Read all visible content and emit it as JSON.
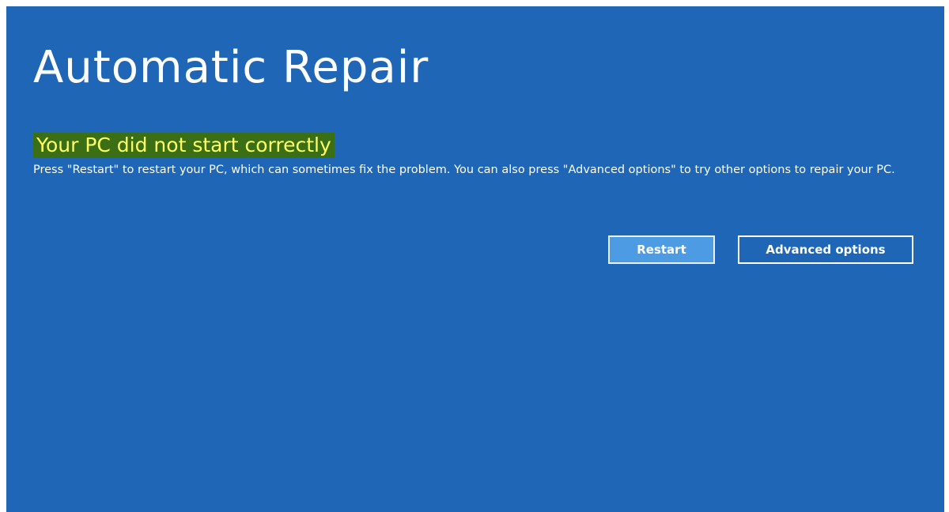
{
  "screen": {
    "title": "Automatic Repair",
    "subtitle": "Your PC did not start correctly",
    "message": "Press \"Restart\" to restart your PC, which can sometimes fix the problem. You can also press \"Advanced options\" to try other options to repair your PC.",
    "buttons": {
      "restart_label": "Restart",
      "advanced_label": "Advanced options"
    }
  },
  "colors": {
    "background": "#1f66b7",
    "subtitle_highlight": "#3b6f16",
    "subtitle_text": "#ffff66",
    "restart_button": "#4d9be2"
  }
}
